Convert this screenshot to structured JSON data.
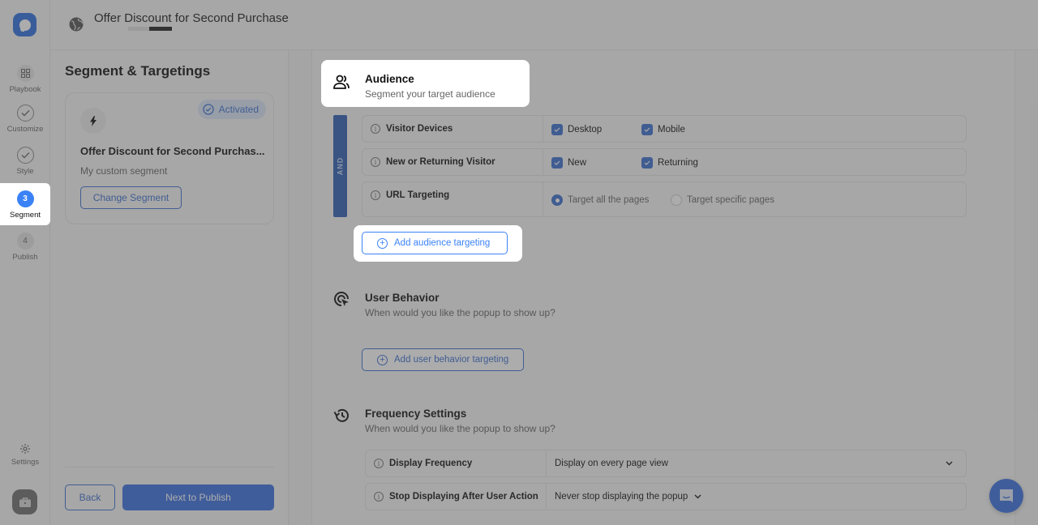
{
  "header": {
    "title": "Offer Discount for Second Purchase",
    "globe_icon": "globe-icon"
  },
  "rail": {
    "logo_icon": "app-logo-icon",
    "steps": [
      {
        "label": "Playbook",
        "marker": "grid-icon",
        "state": "default"
      },
      {
        "label": "Customize",
        "marker": "check-icon",
        "state": "done"
      },
      {
        "label": "Style",
        "marker": "check-icon",
        "state": "done"
      },
      {
        "label": "Segment",
        "marker": "3",
        "state": "active"
      },
      {
        "label": "Publish",
        "marker": "4",
        "state": "upcoming"
      }
    ],
    "settings_label": "Settings",
    "toolbox_icon": "briefcase-icon"
  },
  "left_panel": {
    "heading": "Segment & Targetings",
    "segment_card": {
      "badge": "Activated",
      "icon": "lightning-icon",
      "name": "Offer Discount for Second Purchas...",
      "subtitle": "My custom segment",
      "change_button": "Change Segment"
    },
    "back_button": "Back",
    "next_button": "Next to Publish"
  },
  "audience": {
    "title": "Audience",
    "subtitle": "Segment your target audience",
    "operator": "AND",
    "rows": [
      {
        "label": "Visitor Devices",
        "type": "checkbox",
        "options": [
          {
            "label": "Desktop",
            "checked": true
          },
          {
            "label": "Mobile",
            "checked": true
          }
        ]
      },
      {
        "label": "New or Returning Visitor",
        "type": "checkbox",
        "options": [
          {
            "label": "New",
            "checked": true
          },
          {
            "label": "Returning",
            "checked": true
          }
        ]
      },
      {
        "label": "URL Targeting",
        "type": "radio",
        "options": [
          {
            "label": "Target all the pages",
            "checked": true
          },
          {
            "label": "Target specific pages",
            "checked": false
          }
        ]
      }
    ],
    "add_button": "Add audience targeting"
  },
  "user_behavior": {
    "title": "User Behavior",
    "subtitle": "When would you like the popup to show up?",
    "add_button": "Add user behavior targeting"
  },
  "frequency": {
    "title": "Frequency Settings",
    "subtitle": "When would you like the popup to show up?",
    "rows": [
      {
        "label": "Display Frequency",
        "value": "Display on every page view"
      },
      {
        "label": "Stop Displaying After User Action",
        "value": "Never stop displaying the popup"
      }
    ]
  },
  "colors": {
    "accent": "#3b6fe0",
    "overlay": "rgba(70,70,70,0.45)"
  }
}
